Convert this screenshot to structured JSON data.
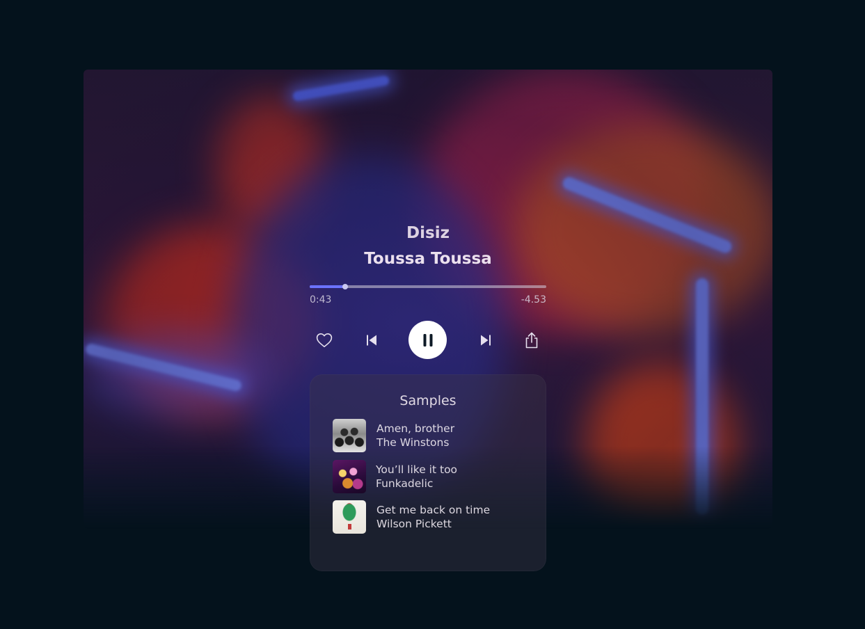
{
  "player": {
    "artist": "Disiz",
    "track": "Toussa Toussa",
    "elapsed": "0:43",
    "remaining": "-4.53",
    "progress_fraction": 0.15,
    "accent_color": "#6c73ff",
    "controls": {
      "like_icon": "heart-icon",
      "previous_icon": "skip-previous-icon",
      "play_pause_icon": "pause-icon",
      "next_icon": "skip-next-icon",
      "share_icon": "share-icon"
    }
  },
  "samples": {
    "title": "Samples",
    "items": [
      {
        "title": "Amen, brother",
        "artist": "The Winstons"
      },
      {
        "title": "You’ll like it too",
        "artist": "Funkadelic"
      },
      {
        "title": "Get me back on time",
        "artist": "Wilson Pickett"
      }
    ]
  },
  "colors": {
    "page_background": "#04121c",
    "play_button": "#ffffff"
  }
}
